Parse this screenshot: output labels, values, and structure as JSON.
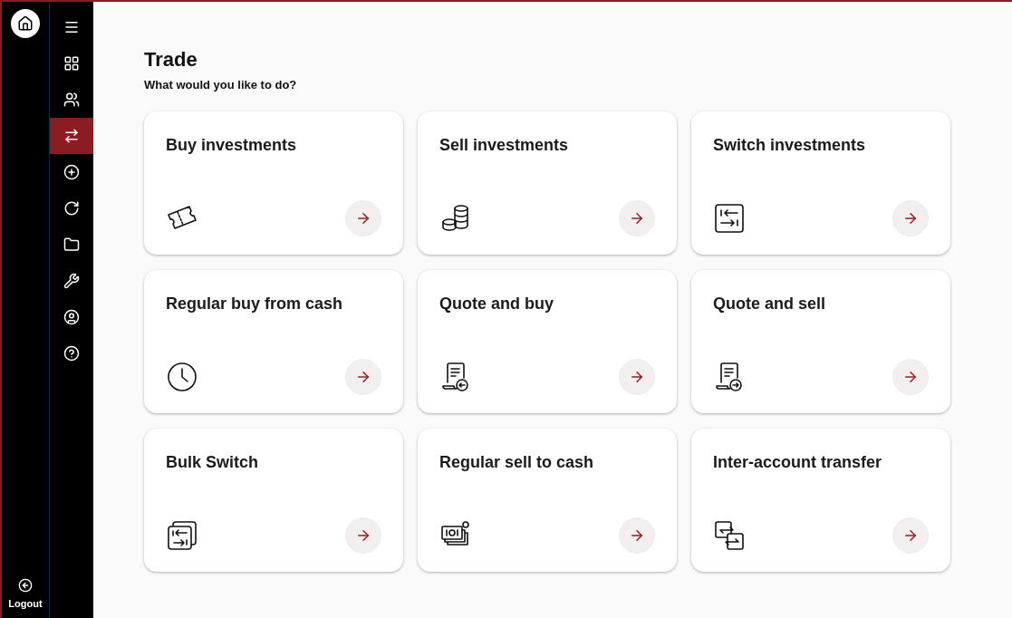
{
  "rail": {
    "logout_label": "Logout"
  },
  "nav": [
    {
      "selected": false
    },
    {
      "selected": false
    },
    {
      "selected": false
    },
    {
      "selected": true
    },
    {
      "selected": false
    },
    {
      "selected": false
    },
    {
      "selected": false
    },
    {
      "selected": false
    },
    {
      "selected": false
    },
    {
      "selected": false
    }
  ],
  "page": {
    "title": "Trade",
    "subtitle": "What would you like to do?"
  },
  "cards": [
    {
      "title": "Buy investments"
    },
    {
      "title": "Sell investments"
    },
    {
      "title": "Switch investments"
    },
    {
      "title": "Regular buy from cash"
    },
    {
      "title": "Quote and buy"
    },
    {
      "title": "Quote and sell"
    },
    {
      "title": "Bulk Switch"
    },
    {
      "title": "Regular sell to cash"
    },
    {
      "title": "Inter-account transfer"
    }
  ]
}
